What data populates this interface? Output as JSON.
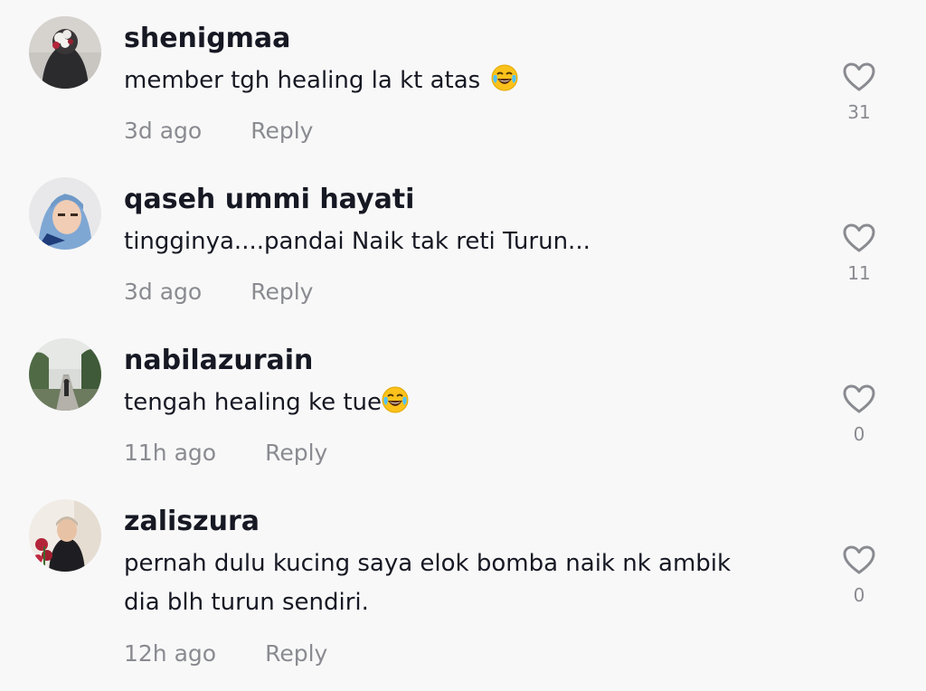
{
  "comments": [
    {
      "username": "shenigmaa",
      "text": "member tgh healing la kt atas",
      "emoji": "😂",
      "time": "3d ago",
      "reply_label": "Reply",
      "likes": "31",
      "avatar_icon": "avatar-photo-flowers"
    },
    {
      "username": "qaseh ummi hayati",
      "text": "tingginya....pandai Naik tak reti Turun...",
      "emoji": "",
      "time": "3d ago",
      "reply_label": "Reply",
      "likes": "11",
      "avatar_icon": "avatar-photo-hijab"
    },
    {
      "username": "nabilazurain",
      "text": "tengah healing ke tue",
      "emoji": "😂",
      "time": "11h ago",
      "reply_label": "Reply",
      "likes": "0",
      "avatar_icon": "avatar-photo-road"
    },
    {
      "username": "zaliszura",
      "text": "pernah dulu kucing saya elok bomba naik nk ambik\ndia blh turun sendiri.",
      "emoji": "",
      "time": "12h ago",
      "reply_label": "Reply",
      "likes": "0",
      "avatar_icon": "avatar-photo-woman"
    }
  ],
  "colors": {
    "background": "#f8f8f8",
    "primary_text": "#161823",
    "secondary_text": "#8a8b91"
  }
}
